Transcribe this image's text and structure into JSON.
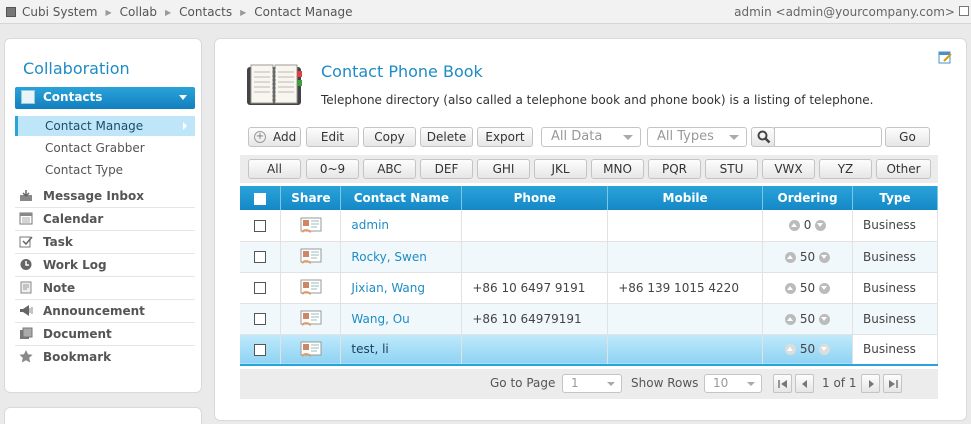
{
  "breadcrumb": [
    "Cubi System",
    "Collab",
    "Contacts",
    "Contact Manage"
  ],
  "user": "admin <admin@yourcompany.com>",
  "sidebar": {
    "title": "Collaboration",
    "active_group": "Contacts",
    "sub_items": [
      "Contact Manage",
      "Contact Grabber",
      "Contact Type"
    ],
    "items": [
      {
        "label": "Message Inbox",
        "icon": "inbox-icon"
      },
      {
        "label": "Calendar",
        "icon": "calendar-icon"
      },
      {
        "label": "Task",
        "icon": "task-icon"
      },
      {
        "label": "Work Log",
        "icon": "clock-icon"
      },
      {
        "label": "Note",
        "icon": "note-icon"
      },
      {
        "label": "Announcement",
        "icon": "megaphone-icon"
      },
      {
        "label": "Document",
        "icon": "document-icon"
      },
      {
        "label": "Bookmark",
        "icon": "star-icon"
      }
    ]
  },
  "main": {
    "title": "Contact Phone Book",
    "description": "Telephone directory (also called a telephone book and phone book) is a listing of telephone."
  },
  "toolbar": {
    "add": "Add",
    "edit": "Edit",
    "copy": "Copy",
    "delete": "Delete",
    "export": "Export",
    "data_filter": "All Data",
    "type_filter": "All Types",
    "search_placeholder": "",
    "go": "Go"
  },
  "alpha_filters": [
    "All",
    "0~9",
    "ABC",
    "DEF",
    "GHI",
    "JKL",
    "MNO",
    "PQR",
    "STU",
    "VWX",
    "YZ",
    "Other"
  ],
  "table": {
    "columns": [
      "",
      "Share",
      "Contact Name",
      "Phone",
      "Mobile",
      "Ordering",
      "Type"
    ],
    "rows": [
      {
        "name": "admin",
        "phone": "",
        "mobile": "",
        "ordering": "0",
        "type": "Business"
      },
      {
        "name": "Rocky, Swen",
        "phone": "",
        "mobile": "",
        "ordering": "50",
        "type": "Business"
      },
      {
        "name": "Jixian, Wang",
        "phone": "+86 10 6497 9191",
        "mobile": "+86 139 1015 4220",
        "ordering": "50",
        "type": "Business"
      },
      {
        "name": "Wang, Ou",
        "phone": "+86 10 64979191",
        "mobile": "",
        "ordering": "50",
        "type": "Business"
      },
      {
        "name": "test, li",
        "phone": "",
        "mobile": "",
        "ordering": "50",
        "type": "Business"
      }
    ]
  },
  "pager": {
    "goto_label": "Go to Page",
    "page": "1",
    "rows_label": "Show Rows",
    "rows": "10",
    "page_info": "1 of 1"
  },
  "colors": {
    "accent": "#1e8cc4",
    "header": "#2aa3d9",
    "selected": "#bfe9fb"
  }
}
